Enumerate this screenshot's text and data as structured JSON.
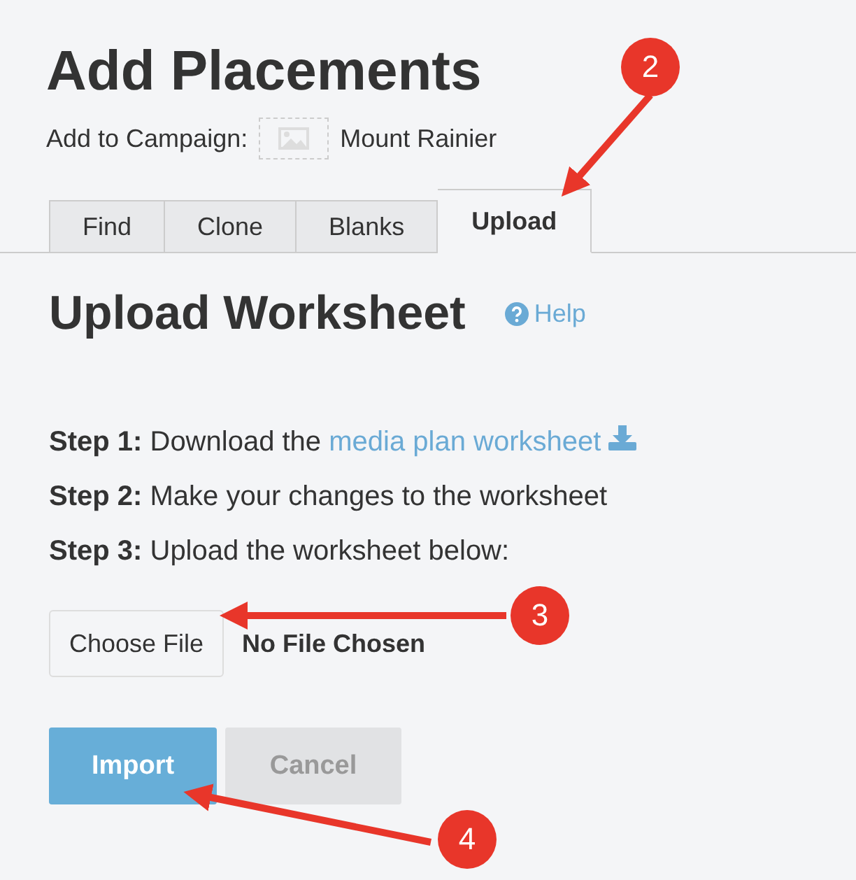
{
  "title": "Add Placements",
  "campaign": {
    "label": "Add to Campaign:",
    "name": "Mount Rainier"
  },
  "tabs": [
    {
      "label": "Find",
      "selected": false
    },
    {
      "label": "Clone",
      "selected": false
    },
    {
      "label": "Blanks",
      "selected": false
    },
    {
      "label": "Upload",
      "selected": true
    }
  ],
  "section": {
    "heading": "Upload Worksheet",
    "help": "Help"
  },
  "steps": [
    {
      "text": "**Step 1:** Download the ",
      "link": "media plan worksheet"
    },
    {
      "text": "**Step 2:** Make your changes to the worksheet"
    },
    {
      "text": "**Step 3:** Upload the worksheet below:"
    }
  ],
  "file_input": {
    "button": "Choose File",
    "status": "No File Chosen"
  },
  "buttons": [
    {
      "label": "Import",
      "kind": "primary",
      "disabled": false
    },
    {
      "label": "Cancel",
      "kind": "secondary",
      "disabled": true
    }
  ],
  "annotations": [
    {
      "number": "2"
    },
    {
      "number": "3"
    },
    {
      "number": "4"
    }
  ]
}
